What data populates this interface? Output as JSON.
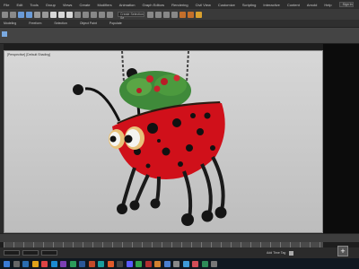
{
  "menubar": {
    "items": [
      "File",
      "Edit",
      "Tools",
      "Group",
      "Views",
      "Create",
      "Modifiers",
      "Animation",
      "Graph Editors",
      "Rendering",
      "Civil View",
      "Customize",
      "Scripting",
      "Interactive",
      "Content",
      "Arnold",
      "Help"
    ],
    "search": "Sign In"
  },
  "toolbar": {
    "select_value": "Create Selection Se"
  },
  "ribbon": {
    "items": [
      "Modeling",
      "Freeform",
      "Selection",
      "Object Paint",
      "Populate"
    ]
  },
  "viewport": {
    "label": "[Perspective] [Default Shading]"
  },
  "statusbar": {
    "text": "Add Time Tag",
    "add_button": "+"
  },
  "colors": {
    "ladybug_red": "#d0101a",
    "viewport_bg": "#cfcfcf",
    "ui_dark": "#2d2d2d"
  }
}
